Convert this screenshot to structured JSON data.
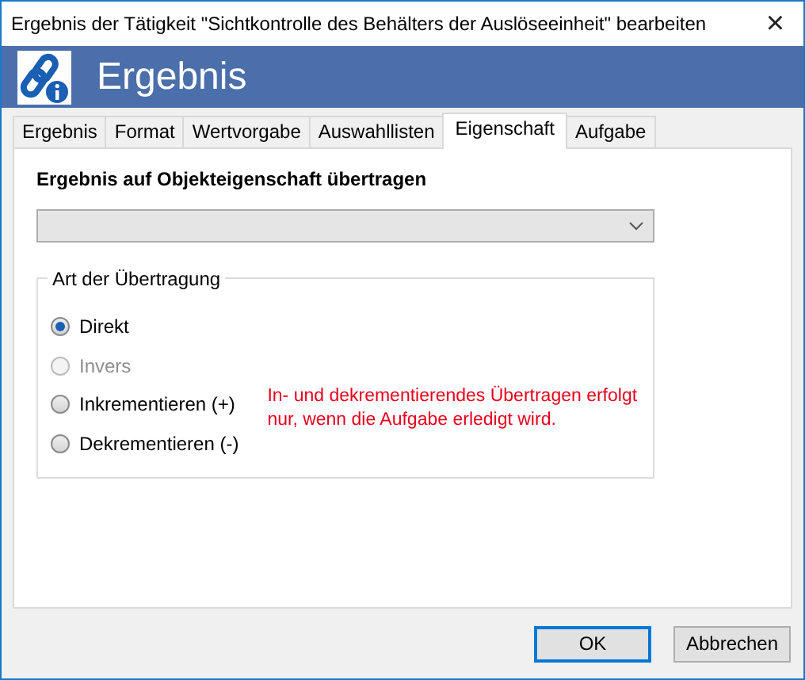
{
  "window": {
    "title": "Ergebnis der Tätigkeit \"Sichtkontrolle des Behälters der Auslöseeinheit\" bearbeiten",
    "close": "×"
  },
  "header": {
    "title": "Ergebnis"
  },
  "tabs": [
    {
      "label": "Ergebnis",
      "selected": false
    },
    {
      "label": "Format",
      "selected": false
    },
    {
      "label": "Wertvorgabe",
      "selected": false
    },
    {
      "label": "Auswahllisten",
      "selected": false
    },
    {
      "label": "Eigenschaft",
      "selected": true
    },
    {
      "label": "Aufgabe",
      "selected": false
    }
  ],
  "property": {
    "label": "Ergebnis auf Objekteigenschaft übertragen",
    "disabled": true
  },
  "transfer": {
    "legend": "Art der Übertragung",
    "options": [
      {
        "label": "Direkt",
        "selected": true,
        "disabled": false
      },
      {
        "label": "Invers",
        "selected": false,
        "disabled": true
      },
      {
        "label": "Inkrementieren (+)",
        "selected": false,
        "disabled": false
      },
      {
        "label": "Dekrementieren (-)",
        "selected": false,
        "disabled": false
      }
    ],
    "note": "In- und dekrementierendes Übertragen erfolgt nur, wenn die Aufgabe erledigt wird."
  },
  "buttons": [
    {
      "label": "OK",
      "default": true
    },
    {
      "label": "Abbrechen",
      "default": false
    }
  ]
}
